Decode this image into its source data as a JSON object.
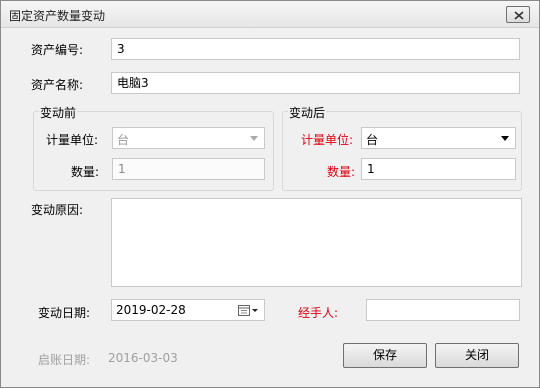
{
  "window": {
    "title": "固定资产数量变动"
  },
  "form": {
    "asset_no_label": "资产编号:",
    "asset_no_value": "3",
    "asset_name_label": "资产名称:",
    "asset_name_value": "电脑3"
  },
  "before": {
    "group_label": "变动前",
    "unit_label": "计量单位:",
    "unit_value": "台",
    "qty_label": "数量:",
    "qty_value": "1"
  },
  "after": {
    "group_label": "变动后",
    "unit_label": "计量单位:",
    "unit_value": "台",
    "qty_label": "数量:",
    "qty_value": "1"
  },
  "reason": {
    "label": "变动原因:",
    "value": ""
  },
  "change_date": {
    "label": "变动日期:",
    "value": "2019-02-28"
  },
  "handler": {
    "label": "经手人:",
    "value": ""
  },
  "open_date": {
    "label": "启账日期:",
    "value": "2016-03-03"
  },
  "buttons": {
    "save": "保存",
    "close": "关闭"
  },
  "colors": {
    "required_label": "#e0000e",
    "disabled_text": "#a0a0a0"
  }
}
